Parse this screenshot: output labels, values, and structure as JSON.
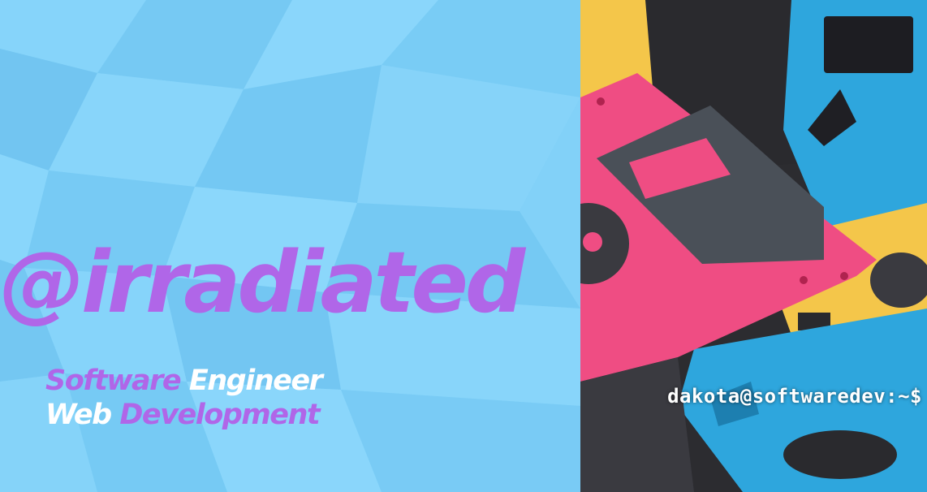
{
  "banner": {
    "handle": "@irradiated",
    "tagline": {
      "line1": {
        "part1": "Software",
        "part2": "Engineer"
      },
      "line2": {
        "part1": "Web",
        "part2": "Development"
      }
    },
    "prompt": "dakota@softwaredev:~$"
  },
  "colors": {
    "background": "#7ed0f8",
    "accent_purple": "#b066e8",
    "text_white": "#ffffff",
    "floppy_pink": "#ef4d83",
    "floppy_blue": "#2ea6dd",
    "floppy_yellow": "#f4c64a",
    "floppy_black": "#2a2a2e"
  },
  "icons": [
    "floppy-disk-photo"
  ]
}
